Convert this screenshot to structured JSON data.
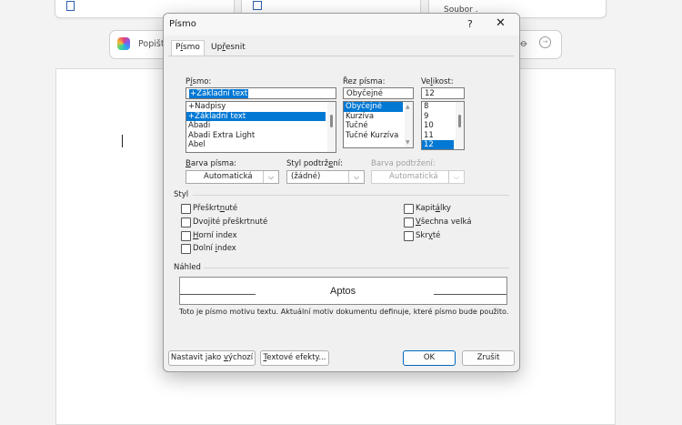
{
  "background": {
    "card3_text": "Soubor .",
    "prompt_text": "Popišt"
  },
  "dialog": {
    "title": "Písmo",
    "help": "?",
    "close": "✕",
    "tabs": [
      "Písmo",
      "Upřesnit"
    ],
    "font_label": "Písmo:",
    "font_value": "+Základní text",
    "font_list": [
      "+Nadpisy",
      "+Základní text",
      "Abadi",
      "Abadi Extra Light",
      "Abel"
    ],
    "font_list_selected": 1,
    "style_label": "Řez písma:",
    "style_value": "Obyčejné",
    "style_list": [
      "Obyčejné",
      "Kurzíva",
      "Tučné",
      "Tučné Kurzíva"
    ],
    "size_label": "Velikost:",
    "size_value": "12",
    "size_list": [
      "8",
      "9",
      "10",
      "11",
      "12"
    ],
    "color_label": "Barva písma:",
    "color_value": "Automatická",
    "underline_label": "Styl podtržení:",
    "underline_value": "(žádné)",
    "underline_color_label": "Barva podtržení:",
    "underline_color_value": "Automatická",
    "effects_label": "Styl",
    "effects_left": [
      "Přeškrtnuté",
      "Dvojité přeškrtnuté",
      "Horní index",
      "Dolní index"
    ],
    "effects_right": [
      "Kapitálky",
      "Všechna velká",
      "Skryté"
    ],
    "preview_label": "Náhled",
    "preview_font": "Aptos",
    "preview_note": "Toto je písmo motivu textu. Aktuální motiv dokumentu definuje, které písmo bude použito.",
    "btn_default": "Nastavit jako výchozí",
    "btn_effects": "Textové efekty...",
    "btn_ok": "OK",
    "btn_cancel": "Zrušit"
  },
  "colors": {
    "selection": "#0078d4",
    "primary_border": "#0067c0"
  }
}
